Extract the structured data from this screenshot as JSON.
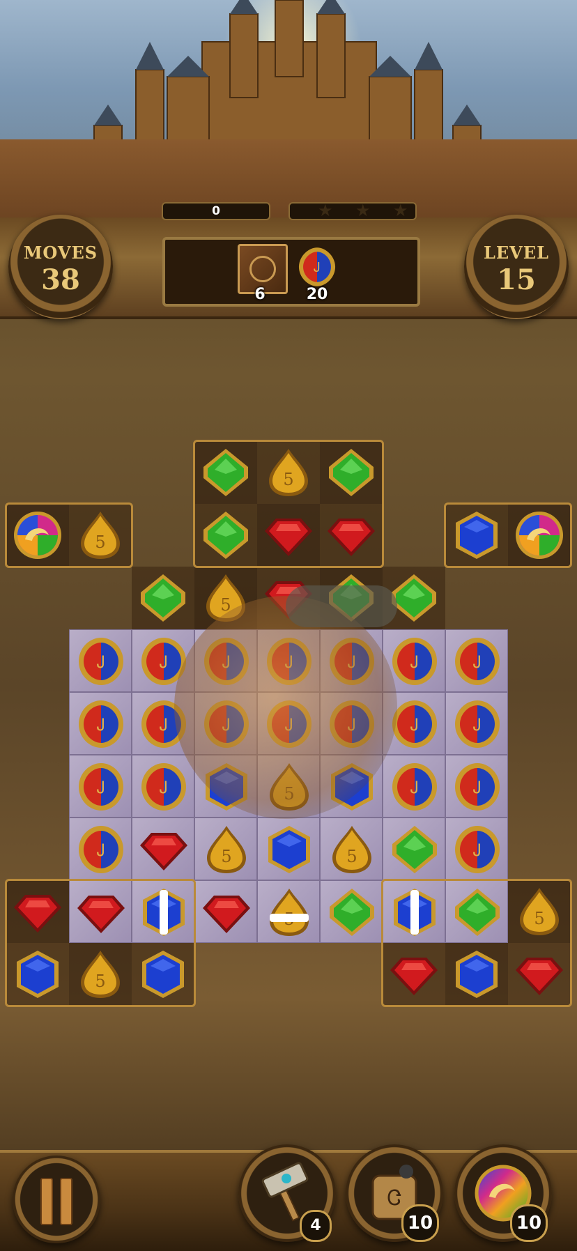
{
  "hud": {
    "moves_label": "MOVES",
    "moves_value": "38",
    "level_label": "LEVEL",
    "level_value": "15",
    "score": "0",
    "stars_total": 3,
    "goals": [
      {
        "item": "crate",
        "count": "6"
      },
      {
        "item": "red-blue-drop-gem",
        "count": "20"
      }
    ]
  },
  "boosters": [
    {
      "name": "hammer",
      "count": "4"
    },
    {
      "name": "bomb",
      "count": "10"
    },
    {
      "name": "rainbow-orb",
      "count": "10"
    }
  ],
  "gem_colors": {
    "green": "#2fae2a",
    "red": "#d11a1e",
    "blue": "#1c3fd0",
    "gold": "#e0a520",
    "rb_red": "#d02a1c",
    "rb_blue": "#2040b8",
    "frame_gold": "#c9992c"
  },
  "board": {
    "rows": [
      [
        null,
        null,
        null,
        "green",
        "gold",
        "green",
        null,
        null,
        null
      ],
      [
        "rainbow",
        "gold",
        null,
        "green",
        "red",
        "red",
        null,
        "blue",
        "rainbow"
      ],
      [
        null,
        null,
        "green",
        "gold",
        "red",
        "green",
        "green",
        null,
        null
      ],
      [
        null,
        "redblue",
        "redblue",
        "redblue",
        "redblue",
        "redblue",
        "redblue",
        "redblue",
        null
      ],
      [
        null,
        "redblue",
        "redblue",
        "redblue",
        "redblue",
        "redblue",
        "redblue",
        "redblue",
        null
      ],
      [
        null,
        "redblue",
        "redblue",
        "blue",
        "gold",
        "blue",
        "redblue",
        "redblue",
        null
      ],
      [
        null,
        "redblue",
        "red",
        "gold",
        "blue",
        "gold",
        "green",
        "redblue",
        null
      ],
      [
        "red",
        "red",
        "blue-striped",
        "red",
        "gold-striped",
        "green",
        "blue-striped",
        "green",
        "gold"
      ],
      [
        "blue",
        "gold",
        "blue",
        null,
        null,
        null,
        "red",
        "blue",
        "red"
      ]
    ],
    "stone_cells": [
      [
        3,
        1
      ],
      [
        3,
        2
      ],
      [
        3,
        3
      ],
      [
        3,
        4
      ],
      [
        3,
        5
      ],
      [
        3,
        6
      ],
      [
        3,
        7
      ],
      [
        4,
        1
      ],
      [
        4,
        2
      ],
      [
        4,
        3
      ],
      [
        4,
        4
      ],
      [
        4,
        5
      ],
      [
        4,
        6
      ],
      [
        4,
        7
      ],
      [
        5,
        1
      ],
      [
        5,
        2
      ],
      [
        5,
        3
      ],
      [
        5,
        4
      ],
      [
        5,
        5
      ],
      [
        5,
        6
      ],
      [
        5,
        7
      ],
      [
        6,
        1
      ],
      [
        6,
        2
      ],
      [
        6,
        3
      ],
      [
        6,
        4
      ],
      [
        6,
        5
      ],
      [
        6,
        6
      ],
      [
        6,
        7
      ],
      [
        7,
        1
      ],
      [
        7,
        2
      ],
      [
        7,
        3
      ],
      [
        7,
        4
      ],
      [
        7,
        5
      ],
      [
        7,
        6
      ],
      [
        7,
        7
      ]
    ]
  }
}
